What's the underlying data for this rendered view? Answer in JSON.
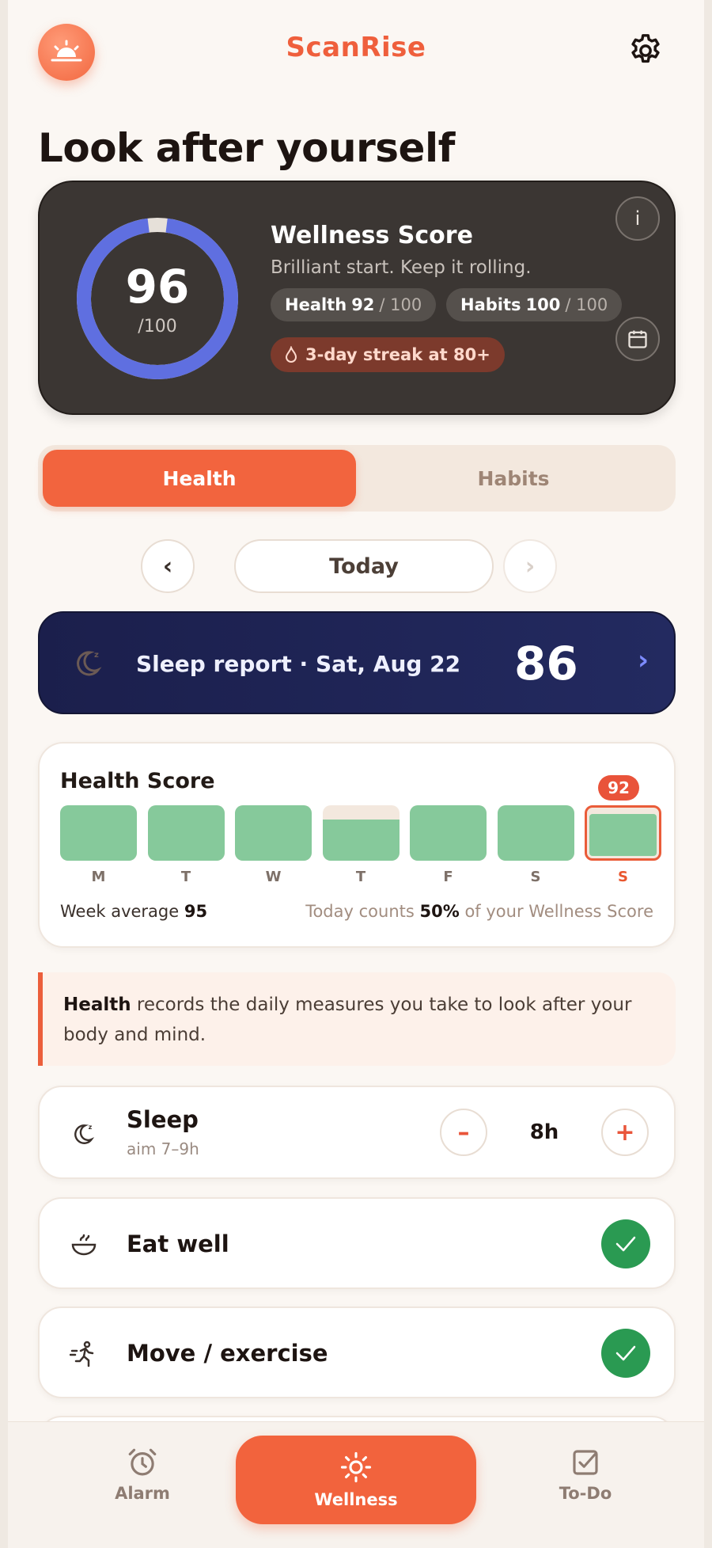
{
  "header": {
    "app_name": "ScanRise",
    "heading": "Look after yourself"
  },
  "wellness_card": {
    "score": "96",
    "score_den": "/100",
    "score_value": 96,
    "title": "Wellness Score",
    "subtitle": "Brilliant start. Keep it rolling.",
    "health_label": "Health",
    "health_value": "92",
    "health_den": "/ 100",
    "habits_label": "Habits",
    "habits_value": "100",
    "habits_den": "/ 100",
    "streak": "3-day streak at 80+",
    "info_glyph": "i",
    "ring_color": "#5f6fe0"
  },
  "tabs": {
    "health": "Health",
    "habits": "Habits",
    "active": "health"
  },
  "date_nav": {
    "prev": "‹",
    "next": "›",
    "label": "Today"
  },
  "sleep_report": {
    "label": "Sleep report · Sat, Aug 22",
    "score": "86",
    "chevron": "›"
  },
  "health_score": {
    "title": "Health Score",
    "days": [
      {
        "label": "M",
        "value": 100
      },
      {
        "label": "T",
        "value": 100
      },
      {
        "label": "W",
        "value": 100
      },
      {
        "label": "T",
        "value": 75
      },
      {
        "label": "F",
        "value": 100
      },
      {
        "label": "S",
        "value": 100
      },
      {
        "label": "S",
        "value": 92,
        "today": true
      }
    ],
    "today_badge": "92",
    "week_avg_label": "Week average",
    "week_avg_value": "95",
    "today_counts_prefix": "Today counts",
    "today_counts_value": "50%",
    "today_counts_suffix": "of your Wellness Score",
    "fill_color": "#86c99b",
    "accent": "#e9533a"
  },
  "note": {
    "bold": "Health",
    "text": " records the daily measures you take to look after your body and mind."
  },
  "habits": {
    "sleep": {
      "title": "Sleep",
      "sub": "aim 7–9h",
      "value": "8h",
      "minus": "–",
      "plus": "+",
      "icon": "moon-icon"
    },
    "eat": {
      "title": "Eat well",
      "icon": "bowl-icon",
      "done": true
    },
    "move": {
      "title": "Move / exercise",
      "icon": "running-icon",
      "done": true
    }
  },
  "bottom_nav": {
    "alarm": "Alarm",
    "wellness": "Wellness",
    "todo": "To-Do",
    "active": "wellness"
  }
}
